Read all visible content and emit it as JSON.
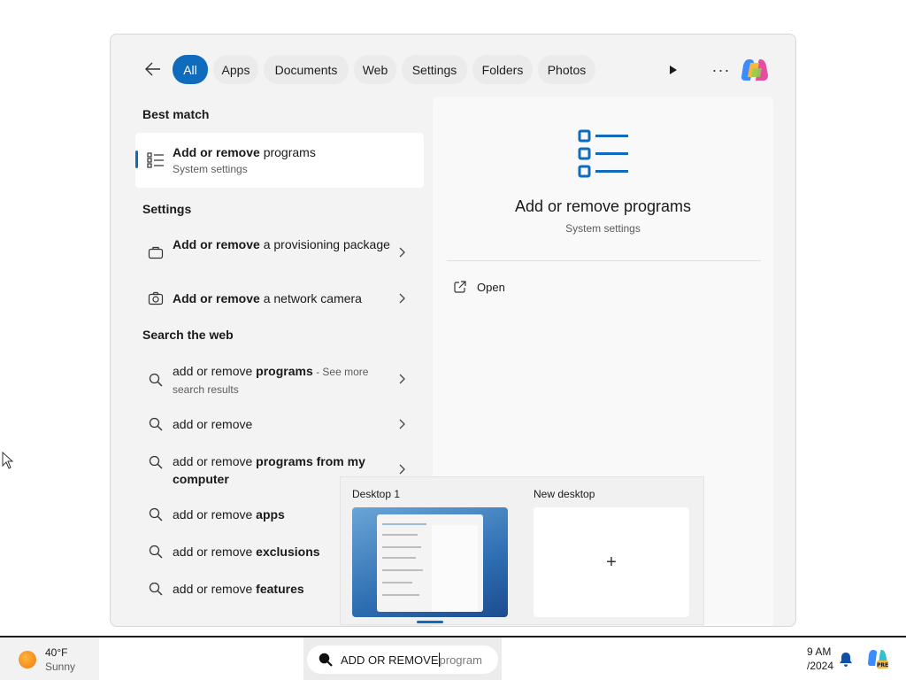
{
  "filters": {
    "tabs": [
      {
        "label": "All",
        "active": true
      },
      {
        "label": "Apps"
      },
      {
        "label": "Documents"
      },
      {
        "label": "Web"
      },
      {
        "label": "Settings"
      },
      {
        "label": "Folders"
      },
      {
        "label": "Photos"
      }
    ],
    "icons": {
      "back": "arrow-left-icon",
      "play": "play-icon",
      "more": "more-horizontal-icon",
      "copilot": "copilot-icon"
    }
  },
  "best_match": {
    "section_title": "Best match",
    "result": {
      "bold": "Add or remove",
      "rest": " programs",
      "subtitle": "System settings",
      "icon": "list-settings-icon"
    }
  },
  "settings": {
    "section_title": "Settings",
    "items": [
      {
        "bold": "Add or remove",
        "rest": " a provisioning package",
        "icon": "briefcase-icon"
      },
      {
        "bold": "Add or remove",
        "rest": " a network camera",
        "icon": "camera-icon"
      }
    ]
  },
  "web": {
    "section_title": "Search the web",
    "items": [
      {
        "plain": "add or remove ",
        "bold": "programs",
        "suffix": " - See more search results"
      },
      {
        "plain": "add or remove",
        "bold": "",
        "suffix": ""
      },
      {
        "plain": "add or remove ",
        "bold": "programs from my computer",
        "suffix": ""
      },
      {
        "plain": "add or remove ",
        "bold": "apps",
        "suffix": ""
      },
      {
        "plain": "add or remove ",
        "bold": "exclusions",
        "suffix": ""
      },
      {
        "plain": "add or remove ",
        "bold": "features",
        "suffix": ""
      }
    ]
  },
  "detail": {
    "title": "Add or remove programs",
    "subtitle": "System settings",
    "actions": [
      {
        "label": "Open",
        "icon": "open-external-icon"
      }
    ]
  },
  "task_view": {
    "desktops": [
      {
        "label": "Desktop 1",
        "current": true
      },
      {
        "label": "New desktop",
        "add_glyph": "+"
      }
    ]
  },
  "taskbar": {
    "weather": {
      "temp": "40°F",
      "condition": "Sunny"
    },
    "search": {
      "typed": "ADD OR REMOVE",
      "suggestion": " program"
    },
    "clock": {
      "time": "9 AM",
      "date": "/2024"
    }
  },
  "colors": {
    "accent": "#0f6cbd",
    "window_bg": "#f3f3f3",
    "pane_bg": "#f9f9f9"
  }
}
